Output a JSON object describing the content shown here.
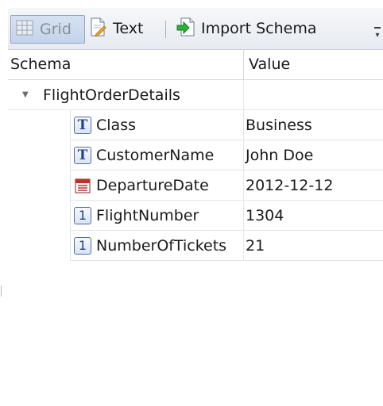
{
  "toolbar": {
    "grid_label": "Grid",
    "text_label": "Text",
    "import_label": "Import Schema"
  },
  "grid": {
    "headers": {
      "schema": "Schema",
      "value": "Value"
    },
    "root": {
      "name": "FlightOrderDetails",
      "expanded": true
    },
    "fields": [
      {
        "name": "Class",
        "type_icon": "text-type-icon",
        "value": "Business"
      },
      {
        "name": "CustomerName",
        "type_icon": "text-type-icon",
        "value": "John Doe"
      },
      {
        "name": "DepartureDate",
        "type_icon": "date-type-icon",
        "value": "2012-12-12"
      },
      {
        "name": "FlightNumber",
        "type_icon": "number-type-icon",
        "value": "1304"
      },
      {
        "name": "NumberOfTickets",
        "type_icon": "number-type-icon",
        "value": "21"
      }
    ]
  },
  "colors": {
    "toolbar_bg": "#e7ebf1",
    "selected_button": "#c3d3ea",
    "icon_blue": "#23428b",
    "grid_line": "#e2e5ea"
  }
}
